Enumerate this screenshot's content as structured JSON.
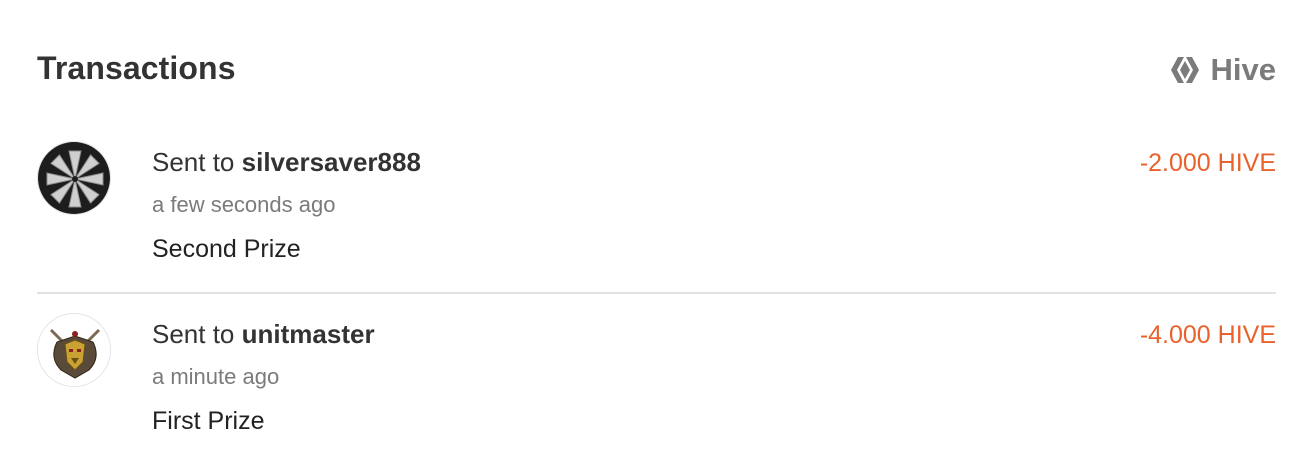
{
  "header": {
    "title": "Transactions",
    "brand_label": "Hive",
    "brand_icon": "hive-logo-icon"
  },
  "colors": {
    "amount_negative": "#e8622c",
    "muted_text": "#7b7b7b",
    "divider": "#e2e2e2"
  },
  "transactions": [
    {
      "direction_label": "Sent to",
      "counterparty": "silversaver888",
      "time": "a few seconds ago",
      "memo": "Second Prize",
      "amount": "-2.000 HIVE",
      "avatar_icon": "silver-bars-avatar"
    },
    {
      "direction_label": "Sent to",
      "counterparty": "unitmaster",
      "time": "a minute ago",
      "memo": "First Prize",
      "amount": "-4.000 HIVE",
      "avatar_icon": "warrior-crest-avatar"
    }
  ]
}
